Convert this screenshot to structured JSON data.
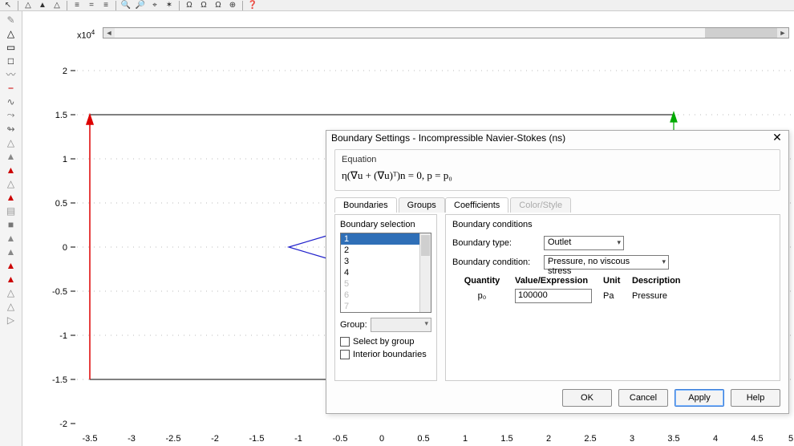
{
  "axis": {
    "exp_prefix": "x10",
    "exp_sup": "4",
    "yticks": [
      "2",
      "1.5",
      "1",
      "0.5",
      "0",
      "-0.5",
      "-1",
      "-1.5",
      "-2"
    ],
    "xticks": [
      "-3.5",
      "-3",
      "-2.5",
      "-2",
      "-1.5",
      "-1",
      "-0.5",
      "0",
      "0.5",
      "1",
      "1.5",
      "2",
      "2.5",
      "3",
      "3.5",
      "4",
      "4.5",
      "5"
    ]
  },
  "dialog": {
    "title": "Boundary Settings - Incompressible Navier-Stokes (ns)",
    "equation_label": "Equation",
    "equation": "η(∇u + (∇u)ᵀ)n = 0, p = p₀",
    "tabs_left": {
      "boundaries": "Boundaries",
      "groups": "Groups"
    },
    "tabs_right": {
      "coefficients": "Coefficients",
      "colorstyle": "Color/Style"
    },
    "boundary_selection_label": "Boundary selection",
    "list": [
      "1",
      "2",
      "3",
      "4",
      "5",
      "6",
      "7"
    ],
    "group_label": "Group:",
    "select_by_group": "Select by group",
    "interior_boundaries": "Interior boundaries",
    "bc_title": "Boundary conditions",
    "btype_label": "Boundary type:",
    "btype_value": "Outlet",
    "bcond_label": "Boundary condition:",
    "bcond_value": "Pressure, no viscous stress",
    "head": {
      "q": "Quantity",
      "v": "Value/Expression",
      "u": "Unit",
      "d": "Description"
    },
    "row": {
      "q": "p₀",
      "v": "100000",
      "u": "Pa",
      "d": "Pressure"
    },
    "buttons": {
      "ok": "OK",
      "cancel": "Cancel",
      "apply": "Apply",
      "help": "Help"
    }
  }
}
